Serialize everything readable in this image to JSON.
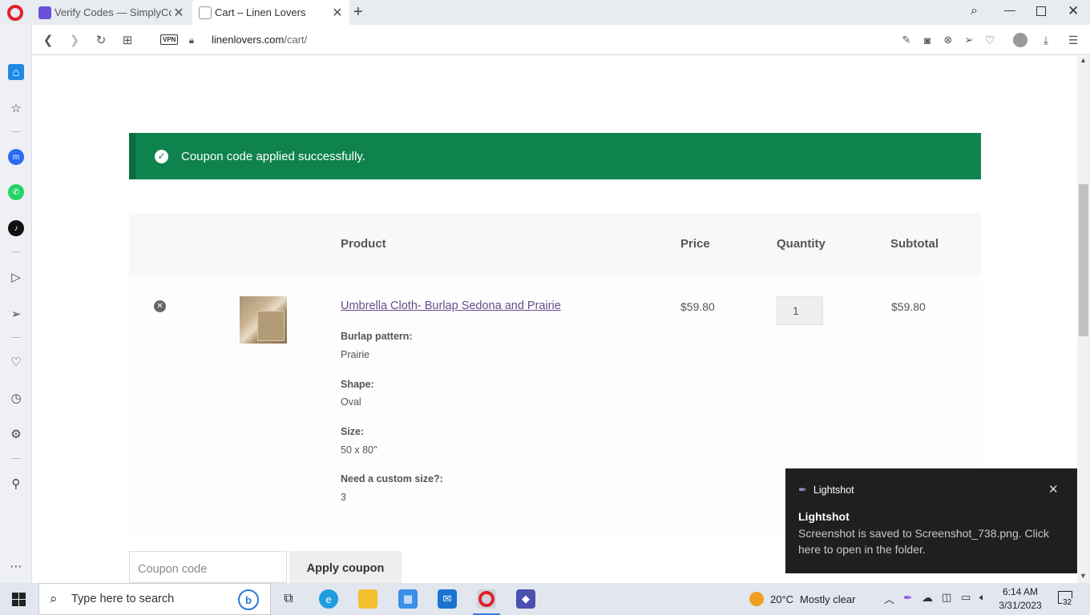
{
  "browser": {
    "tabs": [
      {
        "title": "Verify Codes — SimplyCod",
        "active": false
      },
      {
        "title": "Cart – Linen Lovers",
        "active": true
      }
    ],
    "url_host": "linenlovers.com",
    "url_path": "/cart/",
    "vpn_label": "VPN"
  },
  "notice": {
    "message": "Coupon code applied successfully.",
    "color": "#0f834d"
  },
  "cart": {
    "headers": {
      "product": "Product",
      "price": "Price",
      "quantity": "Quantity",
      "subtotal": "Subtotal"
    },
    "item": {
      "name": "Umbrella Cloth- Burlap Sedona and Prairie",
      "price": "$59.80",
      "quantity": "1",
      "subtotal": "$59.80",
      "meta": [
        {
          "label": "Burlap pattern:",
          "value": "Prairie"
        },
        {
          "label": "Shape:",
          "value": "Oval"
        },
        {
          "label": "Size:",
          "value": "50 x 80\""
        },
        {
          "label": "Need a custom size?:",
          "value": "3"
        }
      ]
    },
    "coupon_placeholder": "Coupon code",
    "apply_coupon_label": "Apply coupon"
  },
  "toast": {
    "app": "Lightshot",
    "title": "Lightshot",
    "body": "Screenshot is saved to Screenshot_738.png. Click here to open in the folder."
  },
  "taskbar": {
    "search_placeholder": "Type here to search",
    "weather_temp": "20°C",
    "weather_desc": "Mostly clear",
    "time": "6:14 AM",
    "date": "3/31/2023",
    "notification_count": "32"
  }
}
